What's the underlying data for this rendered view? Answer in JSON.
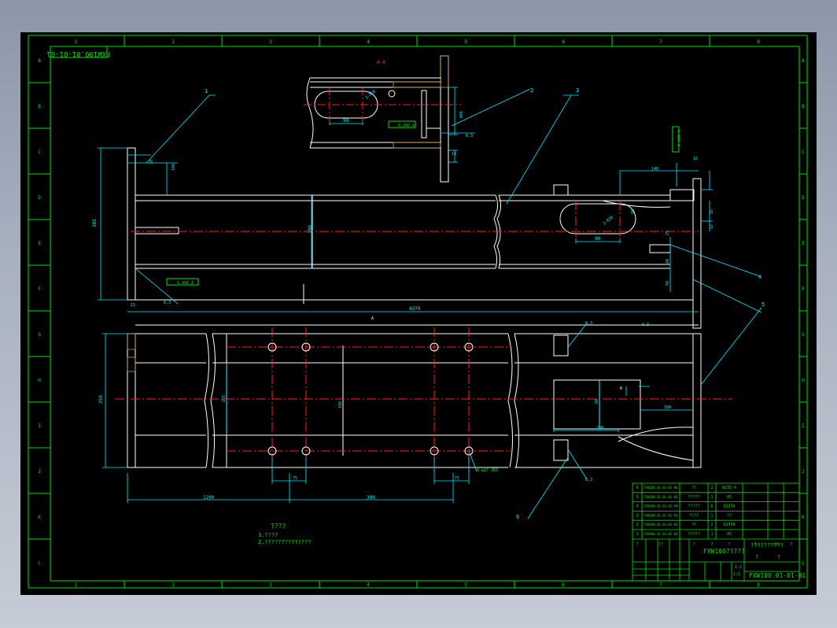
{
  "drawing": {
    "code_top": "FXW100.01-01-01",
    "code_bottom": "FXW100.01-01-01",
    "title_name": "FXW100?????",
    "title_note": "??????????",
    "section_label": "A-A",
    "view_arrow": "A",
    "tech_req_title": "????",
    "tech_req_1": "1.????",
    "tech_req_2": "2.??????????????"
  },
  "border": {
    "cols": [
      "1",
      "2",
      "3",
      "4",
      "5",
      "6",
      "7",
      "8"
    ],
    "rows": [
      "A",
      "B",
      "C",
      "D",
      "E",
      "F",
      "G",
      "H",
      "I",
      "J",
      "K",
      "L"
    ]
  },
  "callouts": [
    "1",
    "2",
    "3",
    "4",
    "5",
    "6"
  ],
  "dims": {
    "d1200": "1200",
    "d390": "390",
    "d4370": "4370",
    "d140": "140",
    "d200": "200",
    "d90a": "90",
    "d90b": "90",
    "d100": "100",
    "d75a": "75",
    "d75b": "75",
    "d250": "250",
    "d265": "265",
    "d160": "160",
    "d100v": "100",
    "d30": "30",
    "d15": "15",
    "d12": "12",
    "d25": "25",
    "d40": "40",
    "d50": "50",
    "d305": "305",
    "d190": "190",
    "d60": "60",
    "d8": "8",
    "d14": "14",
    "d80": "80",
    "r_hole1": "2-R20",
    "r_hole2": "2-R20",
    "holes": "8-φ17 通孔",
    "rough1": "6.3",
    "rough2": "6.3",
    "rough3": "6.3",
    "rough4": "6.3",
    "rough5": "6.3",
    "tol1": "0.300 A",
    "tol2": "0.400 A",
    "tol3": "0.400 A"
  },
  "bom": {
    "rows": [
      {
        "no": "6",
        "code": "FXW100.01-01-01-06",
        "name": "??",
        "qty": "2",
        "mat": "Q235-A"
      },
      {
        "no": "5",
        "code": "FXW100.01-01-01-05",
        "name": "?????",
        "qty": "1",
        "mat": "45"
      },
      {
        "no": "4",
        "code": "FXW100.01-01-01-04",
        "name": "?????",
        "qty": "6",
        "mat": "Q235A"
      },
      {
        "no": "3",
        "code": "FXW100.01-01-01-03",
        "name": "????",
        "qty": "1",
        "mat": "??"
      },
      {
        "no": "2",
        "code": "FXW100.01-01-01-02",
        "name": "??",
        "qty": "2",
        "mat": "Q235A"
      },
      {
        "no": "1",
        "code": "FXW100.01-01-01-01",
        "name": "?????",
        "qty": "1",
        "mat": "45"
      }
    ],
    "header": [
      "?",
      "??",
      "?",
      "?",
      "?",
      "?",
      "??",
      "?",
      "?"
    ]
  },
  "title_block": {
    "q1": "?",
    "q2": "?",
    "scale": "1:2",
    "ratio": "1:1"
  }
}
